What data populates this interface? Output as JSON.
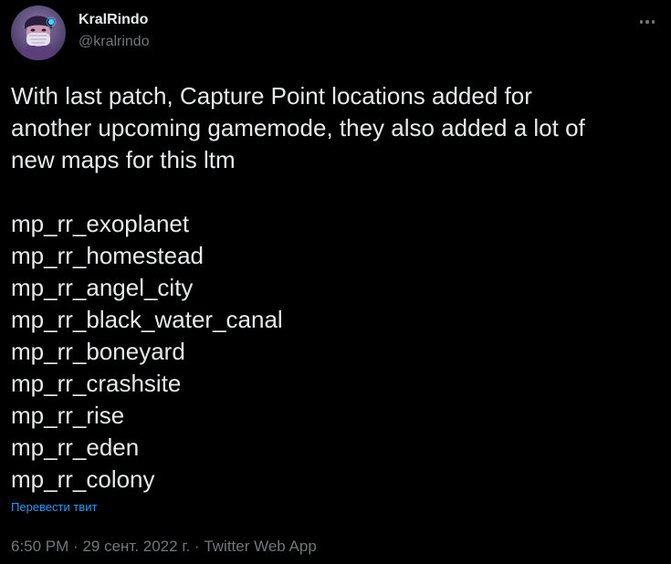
{
  "author": {
    "display_name": "KralRindo",
    "handle": "@kralrindo",
    "avatar_icon": "masked-character-avatar"
  },
  "header": {
    "more_icon": "more-options-icon"
  },
  "tweet": {
    "intro_lines": [
      "With last patch, Capture Point locations added for",
      "another upcoming gamemode, they also added a lot of",
      "new maps for this ltm"
    ],
    "maps": [
      "mp_rr_exoplanet",
      "mp_rr_homestead",
      "mp_rr_angel_city",
      "mp_rr_black_water_canal",
      "mp_rr_boneyard",
      "mp_rr_crashsite",
      "mp_rr_rise",
      "mp_rr_eden",
      "mp_rr_colony"
    ]
  },
  "translate_label": "Перевести твит",
  "meta": {
    "time": "6:50 PM",
    "separator": "·",
    "date": "29 сент. 2022 г.",
    "source": "Twitter Web App"
  },
  "colors": {
    "background": "#000000",
    "text": "#e7e9ea",
    "muted": "#71767b",
    "link": "#1d9bf0"
  }
}
